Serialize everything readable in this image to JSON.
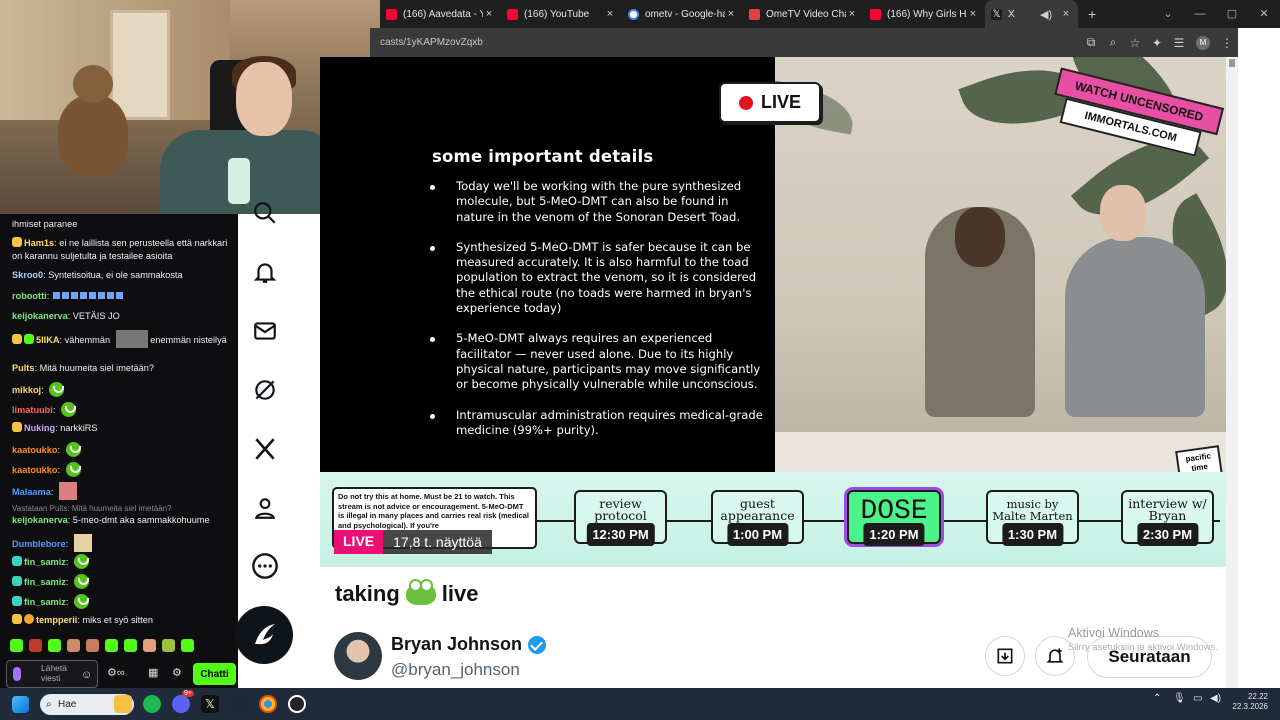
{
  "browser": {
    "tabs": [
      {
        "label": "(166) Aavedata - You",
        "favicon_color": "#ff0033",
        "close": "×"
      },
      {
        "label": "(166) YouTube",
        "favicon_color": "#ff0033",
        "close": "×"
      },
      {
        "label": "ometv - Google-hak",
        "favicon_color": "#4285f4",
        "close": "×"
      },
      {
        "label": "OmeTV Video Chat -",
        "favicon_color": "#e04040",
        "close": "×"
      },
      {
        "label": "(166) Why Girls HATE",
        "favicon_color": "#ff0033",
        "close": "×"
      },
      {
        "label": "X",
        "favicon_color": "#ffffff",
        "close": "×"
      }
    ],
    "new_tab": "+",
    "url": "casts/1yKAPMzovZqxb",
    "profile_initial": "M"
  },
  "chat": {
    "messages": [
      {
        "user": "",
        "text": "ihmiset paranee",
        "color": "#efeff1"
      },
      {
        "user": "Ham1s",
        "text": "ei ne laillista sen perusteella että narkkari on karannu suljetulta ja testailee asioita",
        "color": "#ffd966"
      },
      {
        "user": "Skroo0",
        "text": "Syntetisoitua, ei ole sammakosta",
        "color": "#9fd3ff"
      },
      {
        "user": "robootti",
        "text": "",
        "color": "#7fe87f"
      },
      {
        "user": "keijokanerva",
        "text": "VETÄIS JO",
        "color": "#7fe87f"
      },
      {
        "user": "5IIKA",
        "text": "vähemmän",
        "text2": "enemmän nisteilyä",
        "color": "#ffe066"
      },
      {
        "user": "Pults",
        "text": "Mitä huumeita siel imetään?",
        "color": "#ffd966"
      },
      {
        "user": "mikkoj",
        "text": "",
        "color": "#ffd966"
      },
      {
        "user": "limatuubi",
        "text": "",
        "color": "#ff5c5c"
      },
      {
        "user": "Nuking",
        "text": "narkkiRS",
        "color": "#c9a6ff"
      },
      {
        "user": "kaatoukko",
        "text": "",
        "color": "#ff8c1a"
      },
      {
        "user": "kaatoukko",
        "text": "",
        "color": "#ff8c1a"
      },
      {
        "user": "Malaama",
        "text": "",
        "color": "#4d9bff"
      },
      {
        "user": "",
        "reply": "Vastataan Pults: Mitä huumeita siel imetään?"
      },
      {
        "user": "keijokanerva",
        "text": "5-meo-dmt aka sammakkohuume",
        "color": "#7fe87f"
      },
      {
        "user": "Dumblebore",
        "text": "",
        "color": "#4d9bff"
      },
      {
        "user": "fin_samiz",
        "text": "",
        "color": "#7fe87f"
      },
      {
        "user": "fin_samiz",
        "text": "",
        "color": "#7fe87f"
      },
      {
        "user": "fin_samiz",
        "text": "",
        "color": "#7fe87f"
      },
      {
        "user": "tempperii",
        "text": "miks et syö sitten",
        "color": "#ffe066"
      }
    ],
    "input_placeholder": "Lähetä viesti",
    "send_label": "Chatti"
  },
  "video": {
    "live_badge": "LIVE",
    "slide_title": "some important details",
    "bullets": [
      "Today we'll be working with the pure synthesized molecule, but 5-MeO-DMT can also be found in nature in the venom of the Sonoran Desert Toad.",
      "Synthesized 5-MeO-DMT is safer because it can be measured accurately. It is also harmful to the toad population to extract the venom, so it is considered the ethical route (no toads were harmed in bryan's experience today)",
      "5-MeO-DMT always requires an experienced facilitator — never used alone. Due to its highly physical nature, participants may move significantly or become physically vulnerable while unconscious.",
      "Intramuscular administration requires medical-grade medicine (99%+ purity)."
    ],
    "uncensored_line1": "WATCH UNCENSORED",
    "uncensored_line2": "IMMORTALS.COM",
    "pacific_time": "pacific time",
    "disclaimer": "Do not try this at home. Must be 21 to watch. This stream is not advice or encouragement. 5-MeO-DMT is illegal in many places and carries real risk (medical and psychological). If you're",
    "schedule": [
      {
        "label": "review protocol",
        "time": "12:30 PM"
      },
      {
        "label": "guest appearance",
        "time": "1:00 PM"
      },
      {
        "label": "DOSE",
        "time": "1:20 PM"
      },
      {
        "label": "music by Malte Marten",
        "time": "1:30 PM"
      },
      {
        "label": "interview w/ Bryan",
        "time": "2:30 PM"
      }
    ],
    "live_label": "LIVE",
    "views": "17,8 t. näyttöä"
  },
  "space": {
    "title_before": "taking",
    "title_after": "live",
    "host_name": "Bryan Johnson",
    "host_handle": "@bryan_johnson",
    "follow_label": "Seurataan"
  },
  "windows": {
    "activate_title": "Aktivoi Windows",
    "activate_sub": "Siirry asetuksiin ja aktivoi Windows.",
    "search_label": "Hae",
    "time": "22.22",
    "date": "22.3.2026",
    "discord_badge": "9+"
  }
}
